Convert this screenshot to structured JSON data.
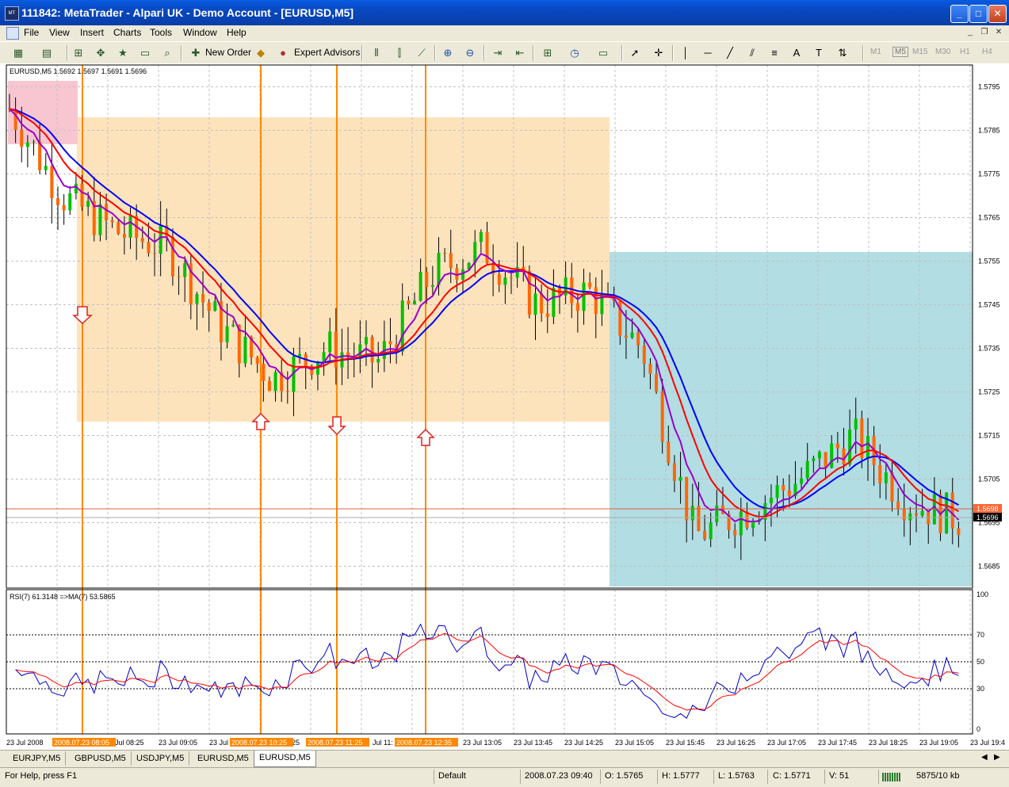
{
  "window": {
    "title": "111842: MetaTrader - Alpari UK - Demo Account - [EURUSD,M5]",
    "app_icon": "mt-icon"
  },
  "menu": {
    "items": [
      "File",
      "View",
      "Insert",
      "Charts",
      "Tools",
      "Window",
      "Help"
    ]
  },
  "toolbar": {
    "new_order": "New Order",
    "expert_advisors": "Expert Advisors",
    "text_tool": "A",
    "timeframes": [
      "M1",
      "M5",
      "M15",
      "M30",
      "H1",
      "H4"
    ],
    "active_timeframe": "M5"
  },
  "chart": {
    "header": "EURUSD,M5  1.5692 1.5697 1.5691 1.5696",
    "price_labels": [
      "1.5795",
      "1.5785",
      "1.5775",
      "1.5765",
      "1.5755",
      "1.5745",
      "1.5735",
      "1.5725",
      "1.5715",
      "1.5705",
      "1.5695",
      "1.5685"
    ],
    "current_price_tag": "1.5696",
    "line_price_tag": "1.5698",
    "time_labels": [
      "23 Jul 2008",
      "Jul 08:25",
      "23 Jul 09:05",
      "23 Jul",
      "25",
      "Jul 11:",
      "23 Jul 13:05",
      "23 Jul 13:45",
      "23 Jul 14:25",
      "23 Jul 15:05",
      "23 Jul 15:45",
      "23 Jul 16:25",
      "23 Jul 17:05",
      "23 Jul 17:45",
      "23 Jul 18:25",
      "23 Jul 19:05",
      "23 Jul 19:4"
    ],
    "time_highlights": [
      "2008.07.23 08:05",
      "2008.07.23 10:25",
      "2008.07.23 11:25",
      "2008.07.23 12:35"
    ],
    "rsi_header": "RSI(7) 61.3148  =>MA(7) 53.5865",
    "rsi_levels": [
      "100",
      "70",
      "50",
      "30",
      "0"
    ],
    "colors": {
      "bull": "#00c000",
      "bear": "#ff6600",
      "ma_red": "#ff0000",
      "ma_blue": "#0000ff",
      "ma_purple": "#9900cc",
      "orange_zone": "#fde3bc",
      "cyan_zone": "#b2dde3",
      "pink_zone": "#f8c6d0",
      "vline": "#ff8800"
    }
  },
  "chart_data": {
    "type": "line",
    "title": "EURUSD,M5",
    "x": [
      "23 Jul 2008",
      "08:25",
      "09:05",
      "09:45",
      "10:25",
      "11:05",
      "11:45",
      "12:25",
      "13:05",
      "13:45",
      "14:25",
      "15:05",
      "15:45",
      "16:25",
      "17:05",
      "17:45",
      "18:25",
      "19:05",
      "19:45"
    ],
    "series": [
      {
        "name": "EURUSD",
        "values": [
          1.579,
          1.577,
          1.5762,
          1.5758,
          1.574,
          1.5728,
          1.5735,
          1.5732,
          1.5752,
          1.5758,
          1.5745,
          1.5748,
          1.5735,
          1.5692,
          1.5698,
          1.5705,
          1.5715,
          1.57,
          1.5696
        ]
      }
    ],
    "ylim": [
      1.568,
      1.58
    ]
  },
  "tabs": [
    "EURJPY,M5",
    "GBPUSD,M5",
    "USDJPY,M5",
    "EURUSD,M5",
    "EURUSD,M5"
  ],
  "active_tab_index": 4,
  "status": {
    "help": "For Help, press F1",
    "profile": "Default",
    "time": "2008.07.23 09:40",
    "open": "O: 1.5765",
    "high": "H: 1.5777",
    "low": "L: 1.5763",
    "close": "C: 1.5771",
    "volume": "V: 51",
    "traffic": "5875/10 kb"
  }
}
